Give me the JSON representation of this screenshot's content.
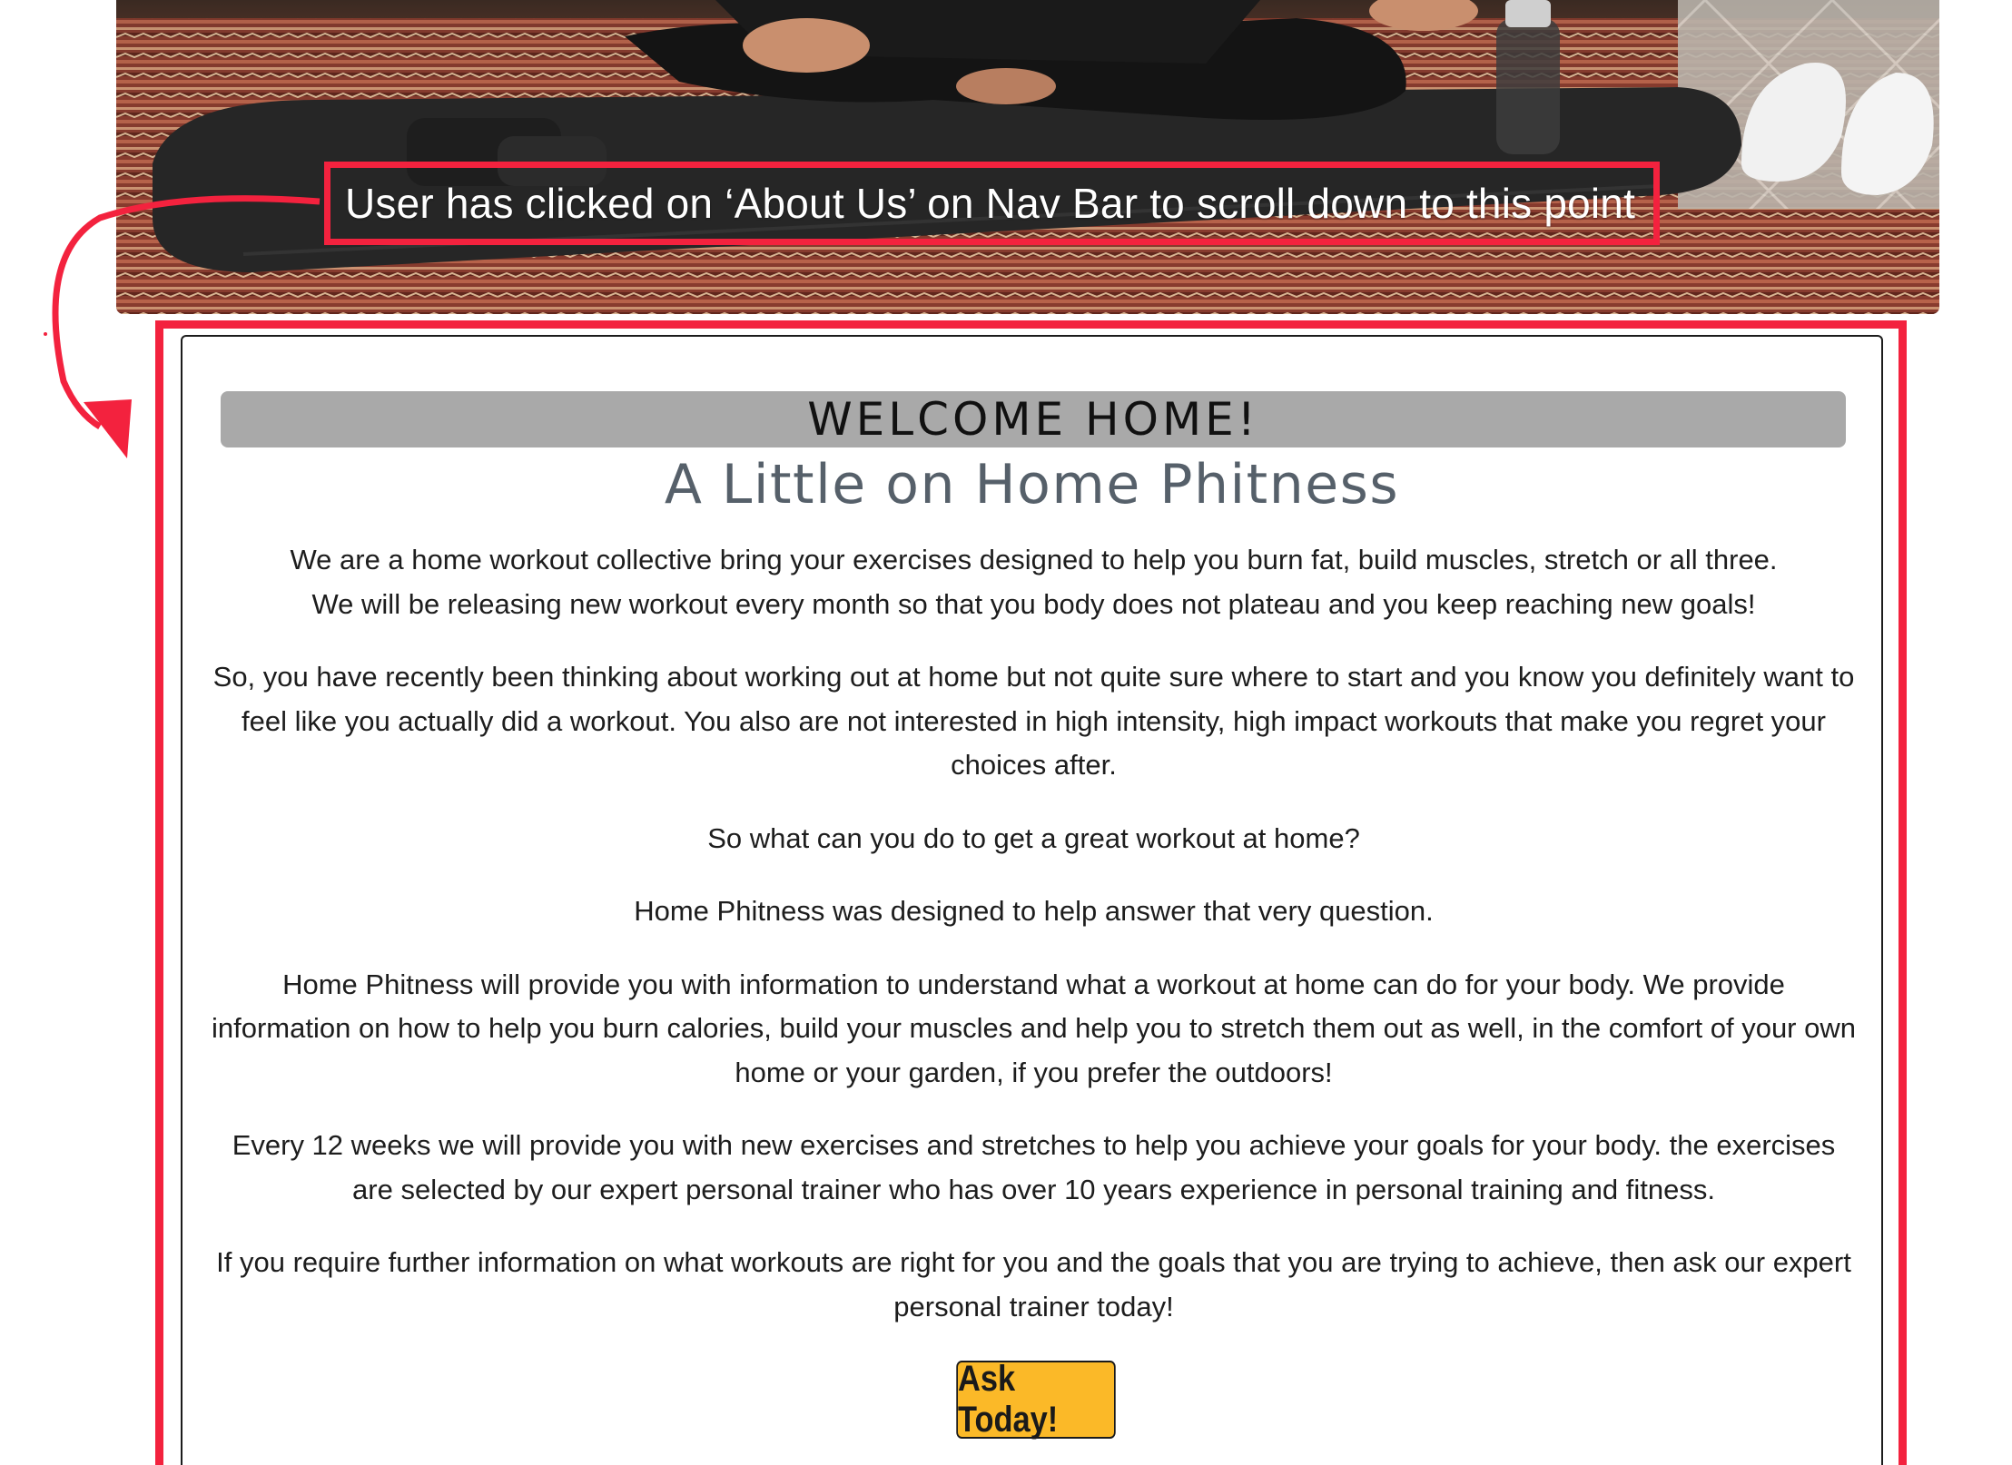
{
  "annotation": {
    "text": "User has clicked on ‘About Us’ on Nav Bar to scroll down to this point",
    "color": "#f3223e"
  },
  "hero": {
    "image_description_icon": "yoga-mat-photo-icon"
  },
  "about": {
    "heading": "WELCOME HOME!",
    "subheading": "A Little on Home Phitness",
    "paragraphs": [
      "We are a home workout collective bring your exercises designed to help you burn fat, build muscles, stretch or all three.",
      "We will be releasing new workout every month so that you body does not plateau and you keep reaching new goals!",
      "So, you have recently been thinking about working out at home but not quite sure where to start and you know you definitely want to feel like you actually did a workout. You also are not interested in high intensity, high impact workouts that make you regret your choices after.",
      "So what can you do to get a great workout at home?",
      "Home Phitness was designed to help answer that very question.",
      "Home Phitness will provide you with information to understand what a workout at home can do for your body. We provide information on how to help you burn calories, build your muscles and help you to stretch them out as well, in the comfort of your own home or your garden, if you prefer the outdoors!",
      "Every 12 weeks we will provide you with new exercises and stretches to help you achieve your goals for your body. the exercises are selected by our expert personal trainer who has over 10 years experience in personal training and fitness.",
      "If you require further information on what workouts are right for you and the goals that you are trying to achieve, then ask our expert personal trainer today!"
    ],
    "button_label": "Ask Today!",
    "colors": {
      "heading_bar": "#a9a9a9",
      "subheading": "#56606a",
      "button": "#fbb928"
    }
  }
}
